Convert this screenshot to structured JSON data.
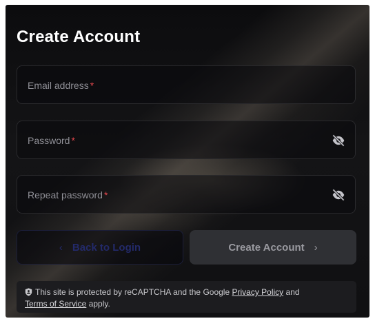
{
  "form": {
    "title": "Create Account",
    "fields": [
      {
        "label": "Email address",
        "required_mark": "*"
      },
      {
        "label": "Password",
        "required_mark": "*",
        "icon": "eye-off-icon"
      },
      {
        "label": "Repeat password",
        "required_mark": "*",
        "icon": "eye-off-icon"
      }
    ],
    "buttons": {
      "back_label": "Back to Login",
      "back_icon": "chevron-left-icon",
      "create_label": "Create Account",
      "create_icon": "chevron-right-icon"
    }
  },
  "recaptcha": {
    "icon": "shield-icon",
    "text_before": "This site is protected by reCAPTCHA and the Google",
    "privacy_link": "Privacy Policy",
    "text_and": "and",
    "terms_link": "Terms of Service",
    "text_after": "apply."
  },
  "colors": {
    "background": "#111113",
    "required": "#e5484d",
    "back_button_text": "#232a6a",
    "create_button_bg": "#2f3034"
  }
}
